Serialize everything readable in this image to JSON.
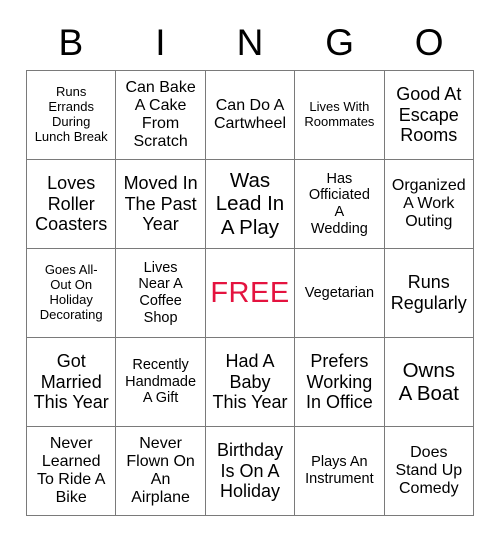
{
  "header": {
    "letters": [
      "B",
      "I",
      "N",
      "G",
      "O"
    ]
  },
  "grid": {
    "columns": 5,
    "rows": 5,
    "border_color": "#7a7a7a",
    "free_color": "#e4133f",
    "cells": [
      {
        "text": "Runs\nErrands\nDuring\nLunch Break",
        "size": "xs",
        "free": false
      },
      {
        "text": "Can Bake\nA Cake\nFrom\nScratch",
        "size": "m",
        "free": false
      },
      {
        "text": "Can Do A\nCartwheel",
        "size": "m",
        "free": false
      },
      {
        "text": "Lives With\nRoommates",
        "size": "xs",
        "free": false
      },
      {
        "text": "Good At\nEscape\nRooms",
        "size": "l",
        "free": false
      },
      {
        "text": "Loves\nRoller\nCoasters",
        "size": "l",
        "free": false
      },
      {
        "text": "Moved In\nThe Past\nYear",
        "size": "l",
        "free": false
      },
      {
        "text": "Was\nLead In\nA Play",
        "size": "xl",
        "free": false
      },
      {
        "text": "Has\nOfficiated\nA\nWedding",
        "size": "s",
        "free": false
      },
      {
        "text": "Organized\nA Work\nOuting",
        "size": "m",
        "free": false
      },
      {
        "text": "Goes All-\nOut On\nHoliday\nDecorating",
        "size": "xs",
        "free": false
      },
      {
        "text": "Lives\nNear A\nCoffee\nShop",
        "size": "s",
        "free": false
      },
      {
        "text": "FREE",
        "size": "xl",
        "free": true
      },
      {
        "text": "Vegetarian",
        "size": "s",
        "free": false
      },
      {
        "text": "Runs\nRegularly",
        "size": "l",
        "free": false
      },
      {
        "text": "Got\nMarried\nThis Year",
        "size": "l",
        "free": false
      },
      {
        "text": "Recently\nHandmade\nA Gift",
        "size": "s",
        "free": false
      },
      {
        "text": "Had A\nBaby\nThis Year",
        "size": "l",
        "free": false
      },
      {
        "text": "Prefers\nWorking\nIn Office",
        "size": "l",
        "free": false
      },
      {
        "text": "Owns\nA Boat",
        "size": "xl",
        "free": false
      },
      {
        "text": "Never\nLearned\nTo Ride A\nBike",
        "size": "m",
        "free": false
      },
      {
        "text": "Never\nFlown On\nAn\nAirplane",
        "size": "m",
        "free": false
      },
      {
        "text": "Birthday\nIs On A\nHoliday",
        "size": "l",
        "free": false
      },
      {
        "text": "Plays An\nInstrument",
        "size": "s",
        "free": false
      },
      {
        "text": "Does\nStand Up\nComedy",
        "size": "m",
        "free": false
      }
    ]
  }
}
